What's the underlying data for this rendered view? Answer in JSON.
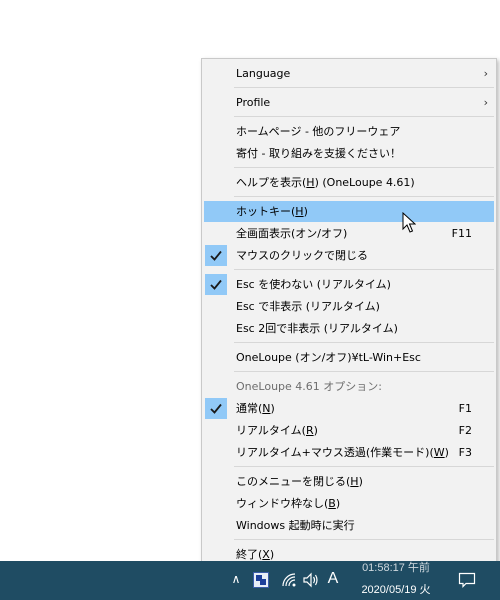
{
  "menu": {
    "items": [
      {
        "label": "Language",
        "submenu": true
      },
      {
        "label": "Profile",
        "submenu": true
      },
      {
        "label": "ホームページ - 他のフリーウェア"
      },
      {
        "label": "寄付 - 取り組みを支援ください！"
      },
      {
        "label_pre": "ヘルプを表示(",
        "accel": "H",
        "label_post": ") (OneLoupe 4.61)"
      },
      {
        "label_pre": "ホットキー(",
        "accel": "H",
        "label_post": ")",
        "highlighted": true
      },
      {
        "label": "全画面表示(オン/オフ)",
        "shortcut": "F11"
      },
      {
        "label": "マウスのクリックで閉じる",
        "checked": true
      },
      {
        "label": "Esc を使わない (リアルタイム)",
        "checked": true
      },
      {
        "label": "Esc で非表示 (リアルタイム)"
      },
      {
        "label": "Esc 2回で非表示 (リアルタイム)"
      },
      {
        "label": "OneLoupe (オン/オフ)¥tL-Win+Esc"
      },
      {
        "label": "OneLoupe 4.61 オプション:",
        "disabled": true
      },
      {
        "label_pre": "通常(",
        "accel": "N",
        "label_post": ")",
        "shortcut": "F1",
        "checked": true
      },
      {
        "label_pre": "リアルタイム(",
        "accel": "R",
        "label_post": ")",
        "shortcut": "F2"
      },
      {
        "label_pre": "リアルタイム+マウス透過(作業モード)(",
        "accel": "W",
        "label_post": ")",
        "shortcut": "F3"
      },
      {
        "label_pre": "このメニューを閉じる(",
        "accel": "H",
        "label_post": ")"
      },
      {
        "label_pre": "ウィンドウ枠なし(",
        "accel": "B",
        "label_post": ")"
      },
      {
        "label": "Windows 起動時に実行"
      },
      {
        "label_pre": "終了(",
        "accel": "X",
        "label_post": ")"
      }
    ]
  },
  "taskbar": {
    "time": "01:58:17 午前",
    "date": "2020/05/19 火",
    "ime": "A",
    "icons": [
      "chevron-up-icon",
      "oneloupe-tray-icon",
      "network-icon",
      "volume-icon",
      "ime-icon",
      "notification-icon"
    ]
  },
  "colors": {
    "highlight": "#91c9f7",
    "taskbar": "#1f4c63",
    "menu_bg": "#f2f2f2"
  }
}
